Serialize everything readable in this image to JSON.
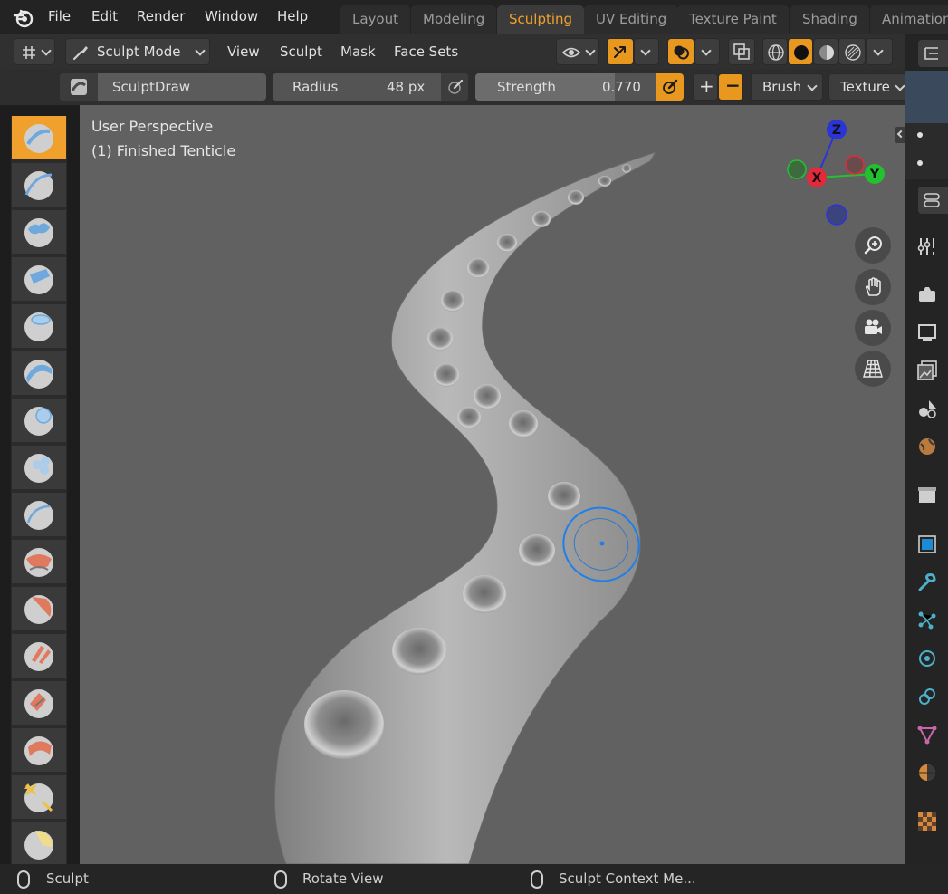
{
  "menu": {
    "file": "File",
    "edit": "Edit",
    "render": "Render",
    "window": "Window",
    "help": "Help"
  },
  "workspaces": [
    {
      "label": "Layout"
    },
    {
      "label": "Modeling"
    },
    {
      "label": "Sculpting"
    },
    {
      "label": "UV Editing"
    },
    {
      "label": "Texture Paint"
    },
    {
      "label": "Shading"
    },
    {
      "label": "Animation"
    }
  ],
  "active_workspace": "Sculpting",
  "header": {
    "mode": "Sculpt Mode",
    "view": "View",
    "sculpt": "Sculpt",
    "mask": "Mask",
    "face_sets": "Face Sets"
  },
  "tool_settings": {
    "brush_name": "SculptDraw",
    "radius_label": "Radius",
    "radius_value": "48 px",
    "strength_label": "Strength",
    "strength_value": "0.770",
    "strength_fraction": 0.77,
    "plus": "+",
    "minus": "−",
    "brush_menu": "Brush",
    "texture_menu": "Texture"
  },
  "viewport": {
    "perspective": "User Perspective",
    "object": "(1) Finished Tenticle",
    "gizmo": {
      "z": "Z",
      "y": "Y",
      "x": "X"
    }
  },
  "statusbar": {
    "left": "Sculpt",
    "middle": "Rotate View",
    "right": "Sculpt Context Me..."
  },
  "colors": {
    "accent": "#f0a02c",
    "viewport_bg": "#616161",
    "axis_x": "#e4293a",
    "axis_y": "#23c12f",
    "axis_z": "#2b34d6",
    "brush_cursor": "#1f7fe8"
  }
}
